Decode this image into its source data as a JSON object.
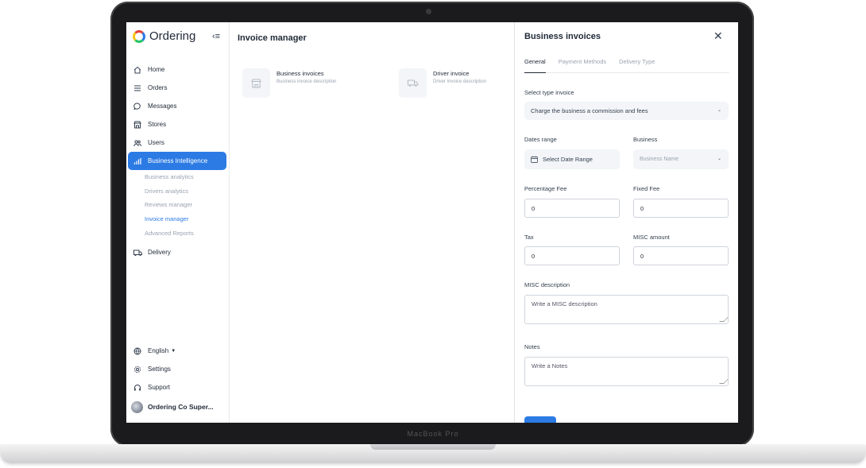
{
  "app": {
    "logo_text": "Ordering",
    "device_brand": "MacBook Pro"
  },
  "sidebar": {
    "items": [
      {
        "label": "Home",
        "icon": "home-icon"
      },
      {
        "label": "Orders",
        "icon": "list-icon"
      },
      {
        "label": "Messages",
        "icon": "chat-icon"
      },
      {
        "label": "Stores",
        "icon": "store-icon"
      },
      {
        "label": "Users",
        "icon": "users-icon"
      },
      {
        "label": "Business Intelligence",
        "icon": "chart-icon",
        "active": true
      },
      {
        "label": "Delivery",
        "icon": "truck-icon"
      }
    ],
    "submenu": [
      "Business analytics",
      "Drivers analytics",
      "Reviews manager",
      "Invoice manager",
      "Advanced Reports"
    ],
    "submenu_current": "Invoice manager",
    "footer": {
      "language": "English",
      "settings": "Settings",
      "support": "Support",
      "user": "Ordering Co Super..."
    }
  },
  "main": {
    "title": "Invoice manager",
    "cards": [
      {
        "title": "Business invoices",
        "description": "Business invoice description",
        "icon": "store-icon"
      },
      {
        "title": "Driver invoice",
        "description": "Driver invoice description",
        "icon": "truck-icon"
      }
    ]
  },
  "drawer": {
    "title": "Business invoices",
    "tabs": [
      "General",
      "Payment Methods",
      "Delivery Type"
    ],
    "active_tab": "General",
    "type_label": "Select type invoice",
    "type_value": "Charge the business a commission and fees",
    "dates_label": "Dates range",
    "dates_placeholder": "Select Date Range",
    "business_label": "Business",
    "business_placeholder": "Business Name",
    "percentage_label": "Percentage Fee",
    "percentage_value": "0",
    "fixed_label": "Fixed Fee",
    "fixed_value": "0",
    "tax_label": "Tax",
    "tax_value": "0",
    "misc_amount_label": "MISC amount",
    "misc_amount_value": "0",
    "misc_desc_label": "MISC description",
    "misc_desc_placeholder": "Write a MISC description",
    "notes_label": "Notes",
    "notes_placeholder": "Write a Notes"
  },
  "colors": {
    "accent": "#2c7be5",
    "text": "#1f2937",
    "muted": "#9aa3b1"
  }
}
